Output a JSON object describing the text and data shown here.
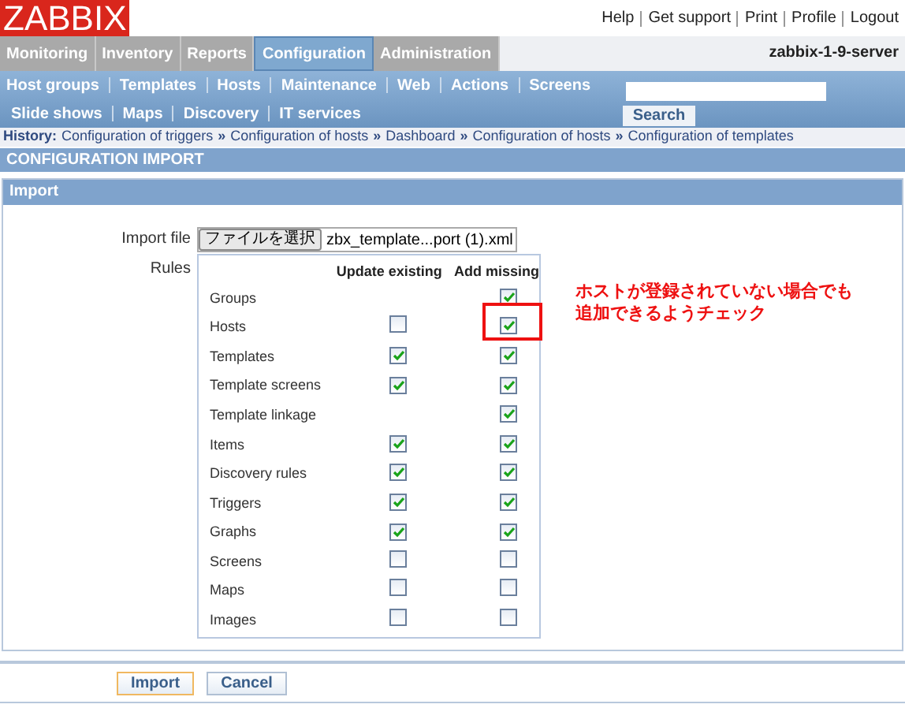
{
  "logo": "ZABBIX",
  "top_links": [
    "Help",
    "Get support",
    "Print",
    "Profile",
    "Logout"
  ],
  "main_tabs": [
    {
      "label": "Monitoring",
      "selected": false
    },
    {
      "label": "Inventory",
      "selected": false
    },
    {
      "label": "Reports",
      "selected": false
    },
    {
      "label": "Configuration",
      "selected": true
    },
    {
      "label": "Administration",
      "selected": false
    }
  ],
  "server_name": "zabbix-1-9-server",
  "sub_menu": [
    [
      "Host groups",
      "Templates",
      "Hosts",
      "Maintenance",
      "Web",
      "Actions",
      "Screens"
    ],
    [
      "Slide shows",
      "Maps",
      "Discovery",
      "IT services"
    ]
  ],
  "search": {
    "button": "Search"
  },
  "history": {
    "label": "History:",
    "separator": "»",
    "items": [
      "Configuration of triggers",
      "Configuration of hosts",
      "Dashboard",
      "Configuration of hosts",
      "Configuration of templates"
    ]
  },
  "page_title": "CONFIGURATION IMPORT",
  "form_title": "Import",
  "import_file": {
    "label": "Import file",
    "button": "ファイルを選択",
    "file_name": "zbx_template...port (1).xml"
  },
  "rules": {
    "label": "Rules",
    "columns": [
      "Update existing",
      "Add missing"
    ],
    "rows": [
      {
        "name": "Groups",
        "add": true
      },
      {
        "name": "Hosts",
        "update": false,
        "add": true
      },
      {
        "name": "Templates",
        "update": true,
        "add": true
      },
      {
        "name": "Template screens",
        "update": true,
        "add": true
      },
      {
        "name": "Template linkage",
        "add": true
      },
      {
        "name": "Items",
        "update": true,
        "add": true
      },
      {
        "name": "Discovery rules",
        "update": true,
        "add": true
      },
      {
        "name": "Triggers",
        "update": true,
        "add": true
      },
      {
        "name": "Graphs",
        "update": true,
        "add": true
      },
      {
        "name": "Screens",
        "update": false,
        "add": false
      },
      {
        "name": "Maps",
        "update": false,
        "add": false
      },
      {
        "name": "Images",
        "update": false,
        "add": false
      }
    ]
  },
  "annotation": {
    "lines": [
      "ホストが登録されていない場合でも",
      "追加できるようチェック"
    ]
  },
  "buttons": [
    "Import",
    "Cancel"
  ]
}
